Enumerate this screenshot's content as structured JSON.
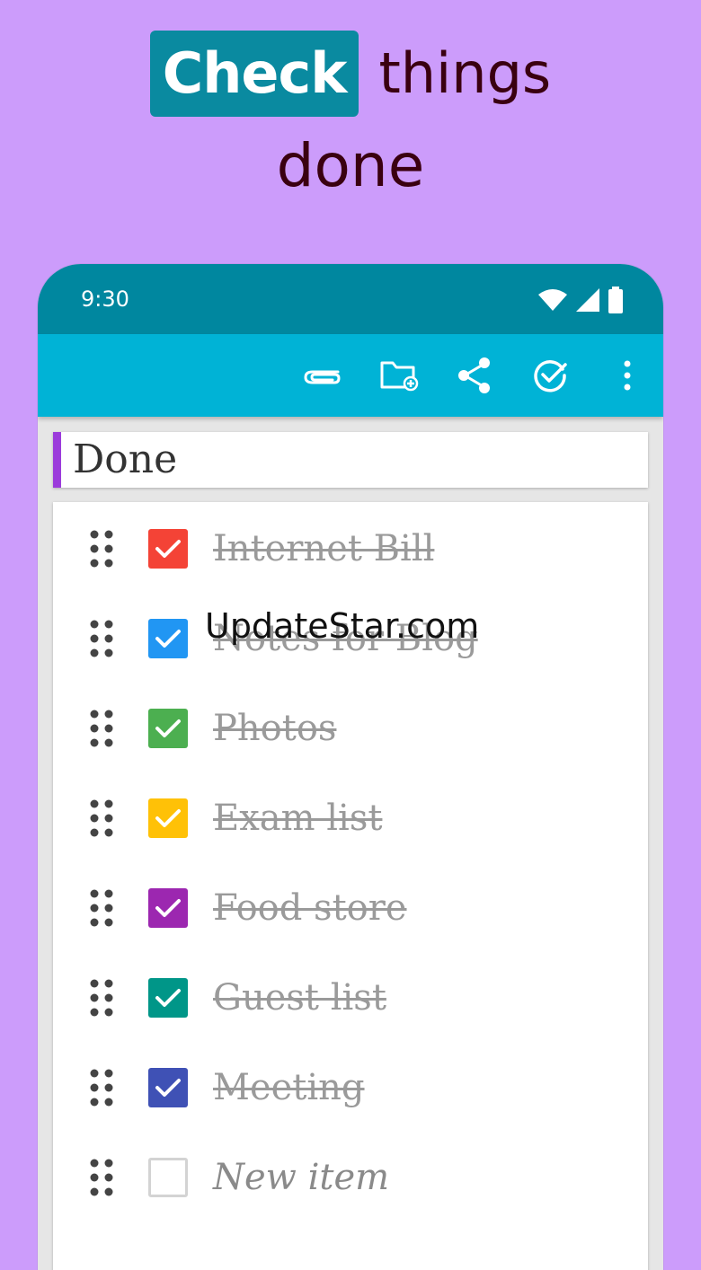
{
  "headline": {
    "highlight_word": "Check",
    "rest_line1": "things",
    "line2": "done"
  },
  "status_bar": {
    "time": "9:30",
    "icons": [
      "wifi-icon",
      "signal-icon",
      "battery-icon"
    ]
  },
  "toolbar": {
    "actions": [
      "paperclip-icon",
      "folder-add-icon",
      "share-icon",
      "check-circle-icon",
      "more-vert-icon"
    ]
  },
  "note": {
    "title": "Done",
    "accent_color": "#9b3bdb",
    "items": [
      {
        "text": "Internet Bill",
        "checked": true,
        "color": "#f44336"
      },
      {
        "text": "Notes for Blog",
        "checked": true,
        "color": "#2196f3"
      },
      {
        "text": "Photos",
        "checked": true,
        "color": "#4caf50"
      },
      {
        "text": "Exam list",
        "checked": true,
        "color": "#ffc107"
      },
      {
        "text": "Food store",
        "checked": true,
        "color": "#9c27b0"
      },
      {
        "text": "Guest list",
        "checked": true,
        "color": "#009688"
      },
      {
        "text": "Meeting",
        "checked": true,
        "color": "#3f51b5"
      }
    ],
    "new_item_placeholder": "New item"
  },
  "watermark": "UpdateStar.com",
  "colors": {
    "background": "#cc9cfb",
    "status_bar": "#00879f",
    "toolbar": "#00b3d6",
    "badge": "#0a8aa0",
    "headline_text": "#3a0010"
  }
}
